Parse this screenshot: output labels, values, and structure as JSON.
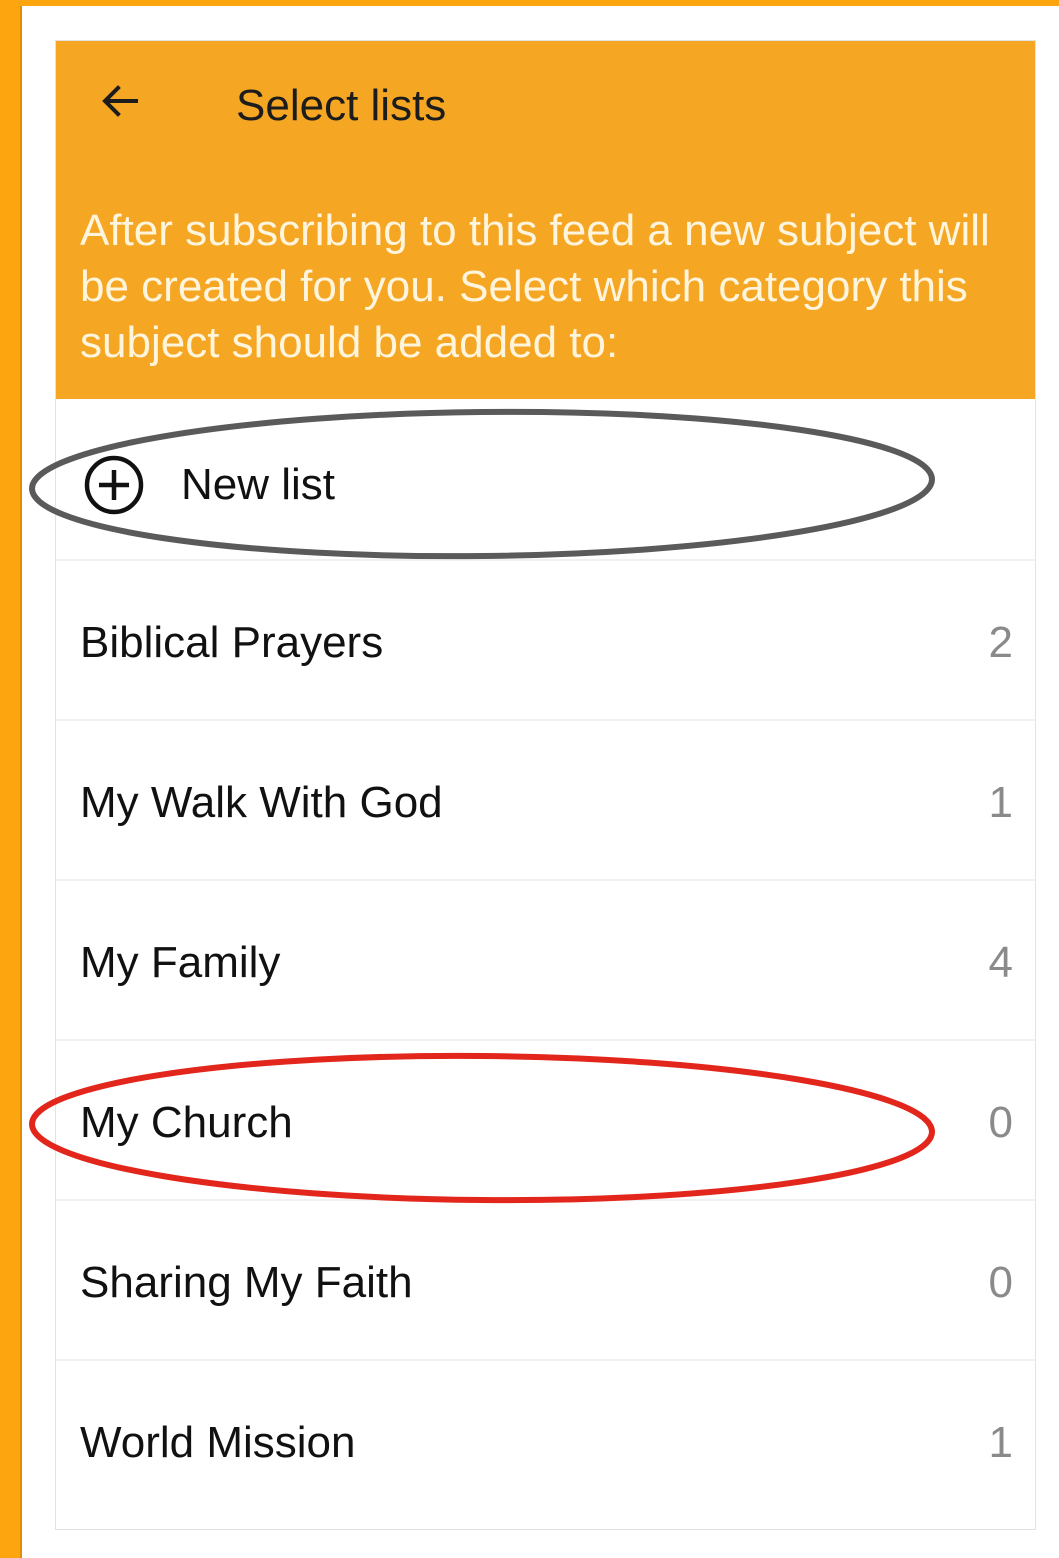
{
  "header": {
    "back_icon": "arrow-left-icon",
    "title": "Select lists",
    "description": "After subscribing to this feed a new subject will be created for you. Select which category this subject should be added to:"
  },
  "new_list": {
    "icon": "plus-circle-icon",
    "label": "New list"
  },
  "lists": [
    {
      "label": "Biblical Prayers",
      "count": "2"
    },
    {
      "label": "My Walk With God",
      "count": "1"
    },
    {
      "label": "My Family",
      "count": "4"
    },
    {
      "label": "My Church",
      "count": "0"
    },
    {
      "label": "Sharing My Faith",
      "count": "0"
    },
    {
      "label": "World Mission",
      "count": "1"
    }
  ],
  "annotations": [
    {
      "target": "New list",
      "color": "#5a5a5a"
    },
    {
      "target": "My Church",
      "color": "#e3261c"
    }
  ],
  "colors": {
    "frame": "#fca50f",
    "header_background": "#f5a623",
    "header_description": "#fff4dc",
    "count_text": "#8a8a8a"
  }
}
